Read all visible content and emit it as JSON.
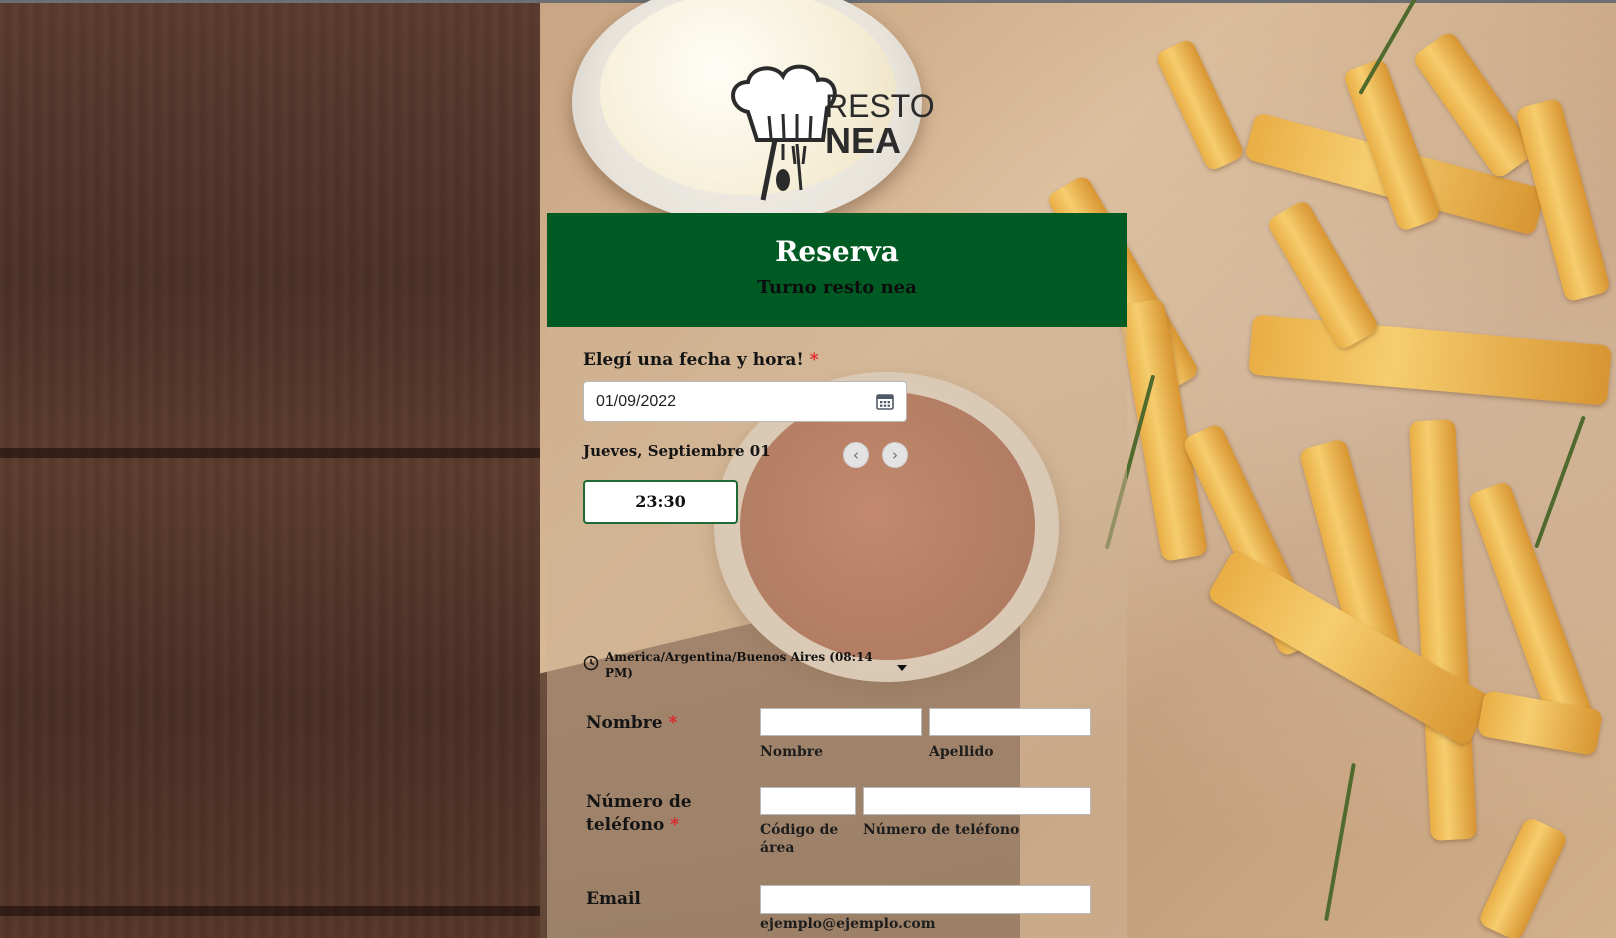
{
  "logo": {
    "line1": "RESTO",
    "line2": "NEA"
  },
  "form": {
    "title": "Reserva",
    "subtitle": "Turno resto nea",
    "date_section": {
      "label": "Elegí una fecha y hora!",
      "required_mark": "*",
      "date_value": "01/09/2022",
      "date_long": "Jueves, Septiembre 01",
      "prev_symbol": "‹",
      "next_symbol": "›",
      "time_slot": "23:30",
      "timezone": "America/Argentina/Buenos Aires (08:14 PM)"
    },
    "name": {
      "label": "Nombre",
      "required_mark": "*",
      "first_sublabel": "Nombre",
      "last_sublabel": "Apellido",
      "first_value": "",
      "last_value": ""
    },
    "phone": {
      "label_line1": "Número de",
      "label_line2": "teléfono",
      "required_mark": "*",
      "area_sublabel": "Código de área",
      "number_sublabel": "Número de teléfono",
      "area_value": "",
      "number_value": ""
    },
    "email": {
      "label": "Email",
      "sublabel": "ejemplo@ejemplo.com",
      "value": ""
    }
  },
  "icons": {
    "calendar": "calendar-icon",
    "clock": "clock-icon",
    "chevron_left": "chevron-left-icon",
    "chevron_right": "chevron-right-icon",
    "caret_down": "caret-down-icon",
    "chef_hat": "chef-hat-icon"
  },
  "colors": {
    "header_green": "#005a23",
    "required_red": "#e0242a",
    "slot_border": "#1f6a35"
  }
}
